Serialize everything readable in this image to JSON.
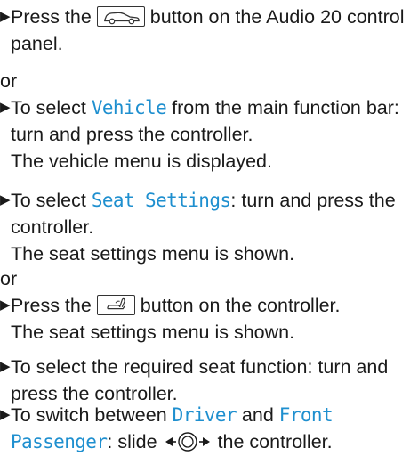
{
  "steps": [
    {
      "pre": "Press the",
      "icon": "car-icon",
      "post": "button on the Audio 20 control panel."
    },
    {
      "pre": "To select",
      "term": "Vehicle",
      "post": "from the main function bar: turn and press the controller.",
      "result": "The vehicle menu is displayed."
    },
    {
      "pre": "To select",
      "term": "Seat Settings",
      "post": ": turn and press the controller.",
      "result": "The seat settings menu is shown."
    },
    {
      "pre": "Press the",
      "icon": "seat-icon",
      "post": "button on the controller.",
      "result": "The seat settings menu is shown."
    },
    {
      "text": "To select the required seat function: turn and press the controller."
    },
    {
      "pre": "To switch between",
      "term1": "Driver",
      "mid": "and",
      "term2": "Front Passenger",
      "post1": ": slide",
      "icon": "slide-left-right-icon",
      "post2": "the controller."
    }
  ],
  "connectors": [
    "or",
    "or"
  ],
  "colors": {
    "menu_term": "#1e8fcf",
    "text": "#1a1a1a"
  }
}
